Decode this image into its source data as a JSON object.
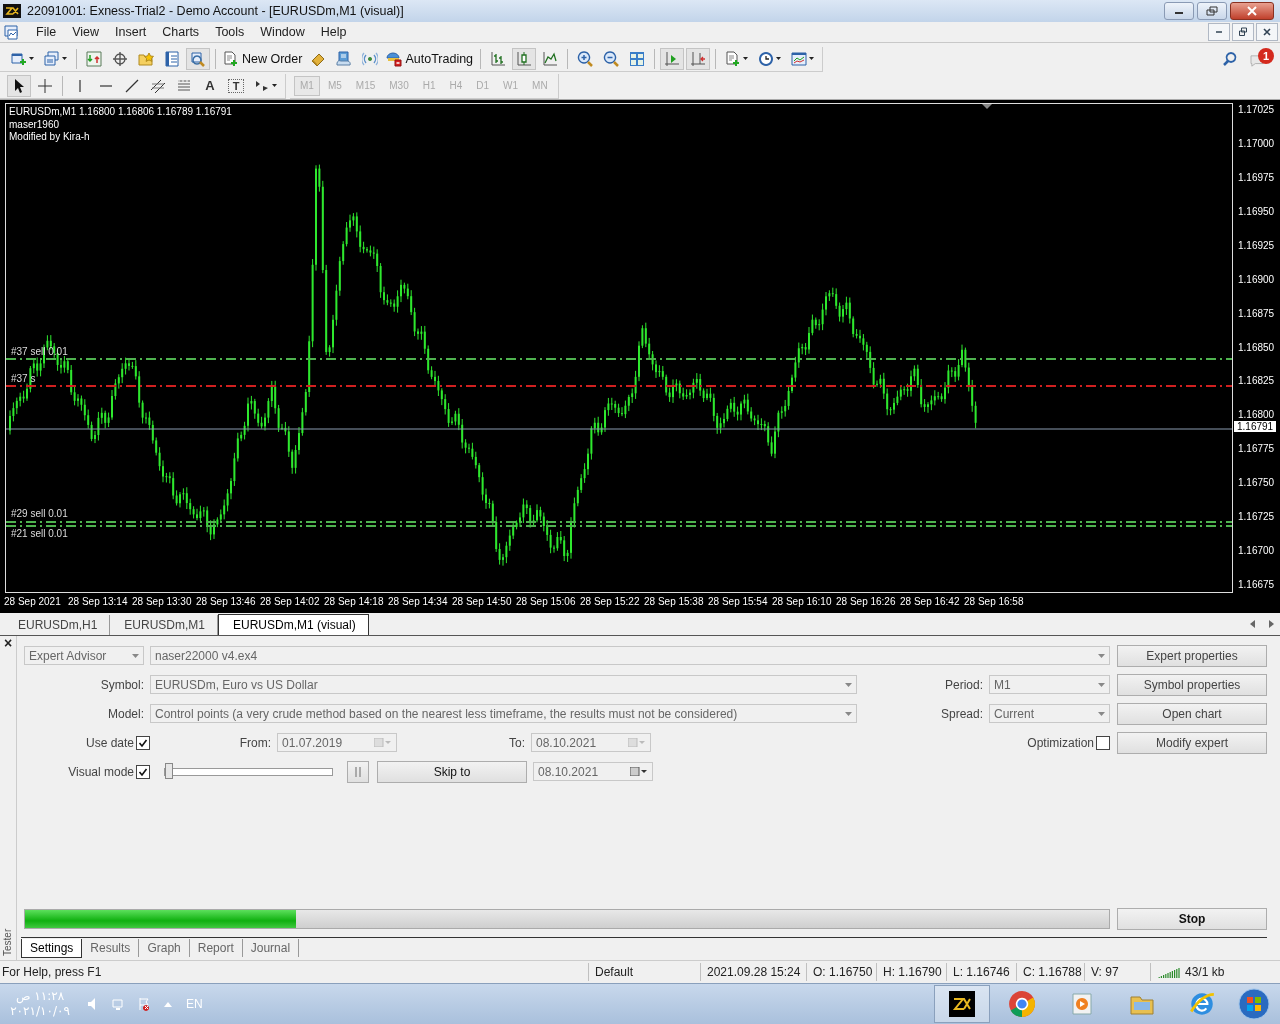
{
  "window": {
    "title": "22091001: Exness-Trial2 - Demo Account - [EURUSDm,M1 (visual)]"
  },
  "menu": [
    "File",
    "View",
    "Insert",
    "Charts",
    "Tools",
    "Window",
    "Help"
  ],
  "toolbar": {
    "new_order": "New Order",
    "autotrading": "AutoTrading",
    "notification_count": "1"
  },
  "drawing_tools": {
    "text_tool": "A",
    "text_label_tool": "T"
  },
  "timeframes": [
    {
      "label": "M1",
      "selected": true,
      "disabled": true
    },
    {
      "label": "M5",
      "selected": false,
      "disabled": true
    },
    {
      "label": "M15",
      "selected": false,
      "disabled": true
    },
    {
      "label": "M30",
      "selected": false,
      "disabled": true
    },
    {
      "label": "H1",
      "selected": false,
      "disabled": true
    },
    {
      "label": "H4",
      "selected": false,
      "disabled": true
    },
    {
      "label": "D1",
      "selected": false,
      "disabled": true
    },
    {
      "label": "W1",
      "selected": false,
      "disabled": true
    },
    {
      "label": "MN",
      "selected": false,
      "disabled": true
    }
  ],
  "chart": {
    "header": [
      "EURUSDm,M1 1.16800 1.16806 1.16789 1.16791",
      "maser1960",
      "Modified by Kira-h"
    ],
    "price_ticks": [
      "1.17025",
      "1.17000",
      "1.16975",
      "1.16950",
      "1.16925",
      "1.16900",
      "1.16875",
      "1.16850",
      "1.16825",
      "1.16800",
      "1.16775",
      "1.16750",
      "1.16725",
      "1.16700",
      "1.16675"
    ],
    "current_price": "1.16791",
    "time_labels": [
      "28 Sep 2021",
      "28 Sep 13:14",
      "28 Sep 13:30",
      "28 Sep 13:46",
      "28 Sep 14:02",
      "28 Sep 14:18",
      "28 Sep 14:34",
      "28 Sep 14:50",
      "28 Sep 15:06",
      "28 Sep 15:22",
      "28 Sep 15:38",
      "28 Sep 15:54",
      "28 Sep 16:10",
      "28 Sep 16:26",
      "28 Sep 16:42",
      "28 Sep 16:58"
    ],
    "order_lines": [
      {
        "label": "#37 sell 0.01",
        "color": "#4fb34f"
      },
      {
        "label": "#37 s",
        "color": "#d02020"
      },
      {
        "label": "#29 sell 0.01",
        "color": "#4fb34f"
      },
      {
        "label": "#21 sell 0.01",
        "color": "#4fb34f"
      }
    ]
  },
  "chart_tabs": [
    {
      "label": "EURUSDm,H1",
      "selected": false
    },
    {
      "label": "EURUSDm,M1",
      "selected": false
    },
    {
      "label": "EURUSDm,M1 (visual)",
      "selected": true
    }
  ],
  "tester": {
    "side_label": "Tester",
    "close": "×",
    "type": "Expert Advisor",
    "expert": "naser22000 v4.ex4",
    "symbol_label": "Symbol:",
    "symbol": "EURUSDm, Euro vs US Dollar",
    "model_label": "Model:",
    "model": "Control points (a very crude method based on the nearest less timeframe, the results must not be considered)",
    "period_label": "Period:",
    "period": "M1",
    "spread_label": "Spread:",
    "spread": "Current",
    "use_date": {
      "label": "Use date",
      "checked": true
    },
    "from_label": "From:",
    "from": "01.07.2019",
    "to_label": "To:",
    "to": "08.10.2021",
    "optimization": {
      "label": "Optimization",
      "checked": false
    },
    "visual_mode": {
      "label": "Visual mode",
      "checked": true
    },
    "speed": {
      "level": 0
    },
    "skip_to": "Skip to",
    "skip_date": "08.10.2021",
    "buttons": [
      "Expert properties",
      "Symbol properties",
      "Open chart",
      "Modify expert"
    ],
    "progress": {
      "level": 0.25
    },
    "stop": "Stop",
    "tabs": [
      {
        "label": "Settings",
        "selected": true
      },
      {
        "label": "Results",
        "selected": false
      },
      {
        "label": "Graph",
        "selected": false
      },
      {
        "label": "Report",
        "selected": false
      },
      {
        "label": "Journal",
        "selected": false
      }
    ]
  },
  "status_bar": [
    "For Help, press F1",
    "Default",
    "2021.09.28 15:24",
    "O: 1.16750",
    "H: 1.16790",
    "L: 1.16746",
    "C: 1.16788",
    "V: 97",
    "43/1 kb"
  ],
  "taskbar": {
    "time": "١١:٢٨ ص",
    "date": "٢٠٢١/١٠/٠٩",
    "language": "EN"
  }
}
